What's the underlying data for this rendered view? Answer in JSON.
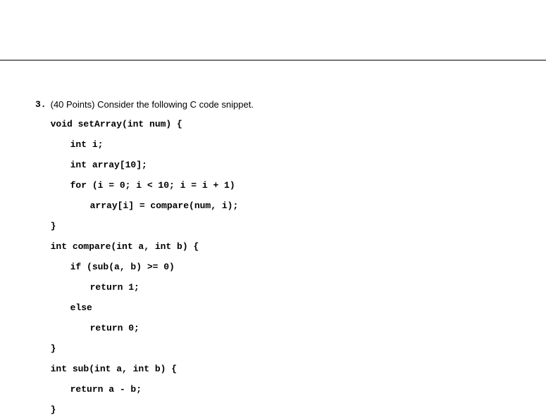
{
  "question": {
    "number": "3.",
    "prompt": "(40 Points) Consider the following C code snippet.",
    "code": {
      "l1": "void setArray(int num) {",
      "l2": "int i;",
      "l3": "int array[10];",
      "l4": "for (i = 0; i < 10; i = i + 1)",
      "l5": "array[i] = compare(num, i);",
      "l6": "}",
      "l7": "int compare(int a, int b) {",
      "l8": "if (sub(a, b) >= 0)",
      "l9": "return 1;",
      "l10": "else",
      "l11": "return 0;",
      "l12": "}",
      "l13": "int sub(int a, int b) {",
      "l14": "return a - b;",
      "l15": "}"
    }
  }
}
